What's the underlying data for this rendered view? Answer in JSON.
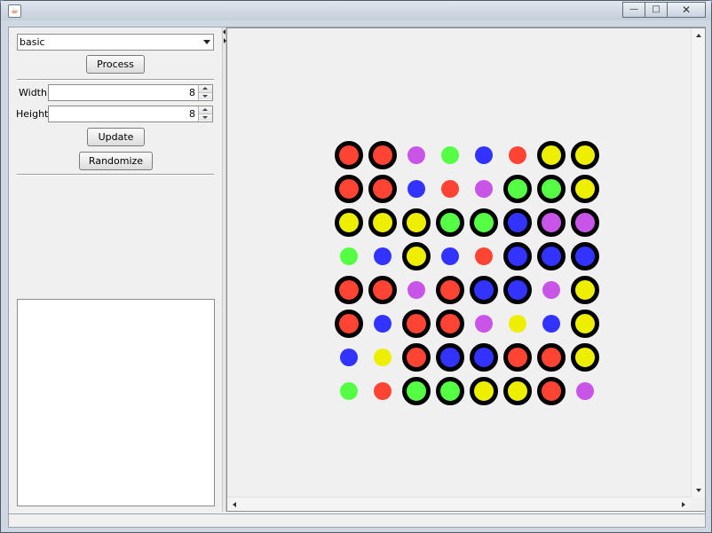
{
  "window": {
    "title": ""
  },
  "controls": {
    "mode_select": "basic",
    "process_label": "Process",
    "width_label": "Width",
    "width_value": "8",
    "height_label": "Height",
    "height_value": "8",
    "update_label": "Update",
    "randomize_label": "Randomize"
  },
  "colors": {
    "red": "#ff4433",
    "green": "#55ff44",
    "blue": "#3333ff",
    "purple": "#c855e8",
    "yellow": "#eeee00",
    "ring": "#000000"
  },
  "board": {
    "size": 8,
    "rows": [
      [
        "R*",
        "R*",
        "P",
        "G",
        "B",
        "R",
        "Y*",
        "Y*"
      ],
      [
        "R*",
        "R*",
        "B",
        "R",
        "P",
        "G*",
        "G*",
        "Y*"
      ],
      [
        "Y*",
        "Y*",
        "Y*",
        "G*",
        "G*",
        "B*",
        "P*",
        "P*"
      ],
      [
        "G",
        "B",
        "Y*",
        "B",
        "R",
        "B*",
        "B*",
        "B*"
      ],
      [
        "R*",
        "R*",
        "P",
        "R*",
        "B*",
        "B*",
        "P",
        "Y*"
      ],
      [
        "R*",
        "B",
        "R*",
        "R*",
        "P",
        "Y",
        "B",
        "Y*"
      ],
      [
        "B",
        "Y",
        "R*",
        "B*",
        "B*",
        "R*",
        "R*",
        "Y*"
      ],
      [
        "G",
        "R",
        "G*",
        "G*",
        "Y*",
        "Y*",
        "R*",
        "P"
      ]
    ]
  }
}
